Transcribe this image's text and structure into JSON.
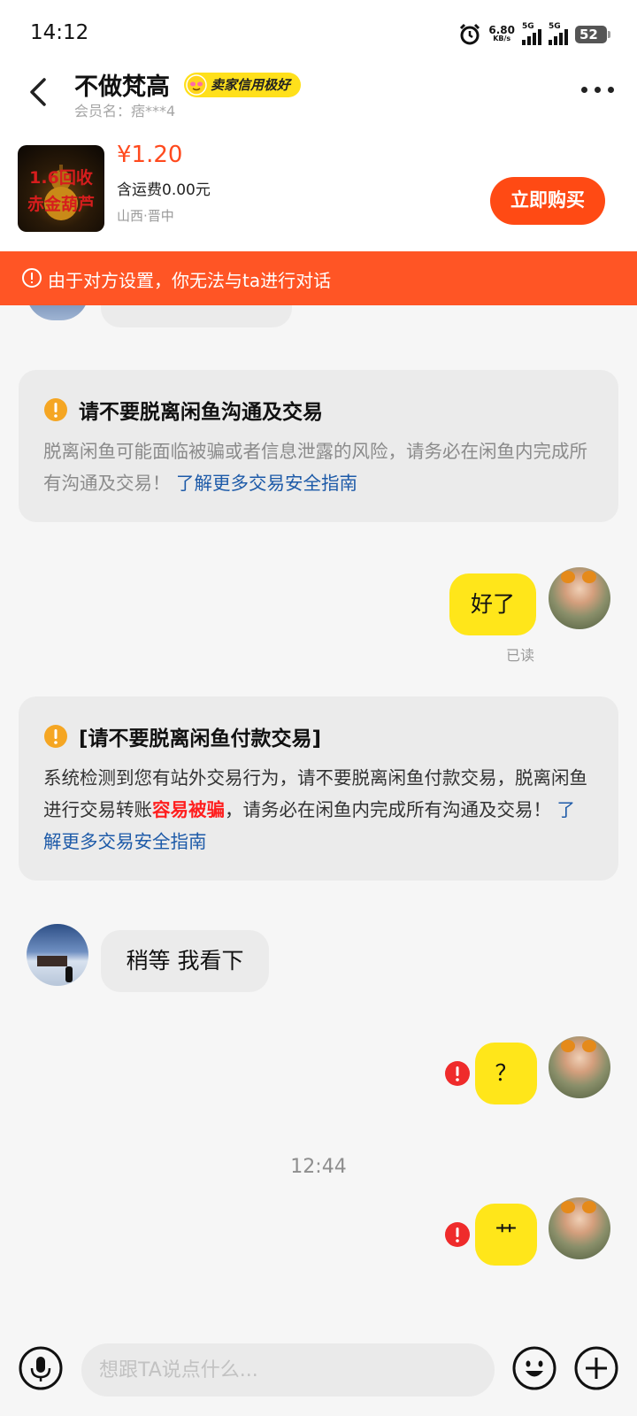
{
  "status_bar": {
    "time": "14:12",
    "net_speed_value": "6.80",
    "net_speed_unit": "KB/s",
    "signal_1_label": "5G",
    "signal_2_label": "5G",
    "battery": "52"
  },
  "header": {
    "seller_name": "不做梵高",
    "credit_badge": "卖家信用极好",
    "member_label": "会员名：痞***4"
  },
  "product": {
    "thumb_line1": "1.6回收",
    "thumb_line2": "赤金葫芦",
    "price": "¥1.20",
    "shipping": "含运费0.00元",
    "location": "山西·晋中",
    "buy_label": "立即购买"
  },
  "banner": {
    "text": "由于对方设置，你无法与ta进行对话"
  },
  "notices": [
    {
      "title": "请不要脱离闲鱼沟通及交易",
      "body": "脱离闲鱼可能面临被骗或者信息泄露的风险，请务必在闲鱼内完成所有沟通及交易！",
      "link": "了解更多交易安全指南"
    },
    {
      "title": "[请不要脱离闲鱼付款交易]",
      "body_before": "系统检测到您有站外交易行为，请不要脱离闲鱼付款交易，脱离闲鱼进行交易转账",
      "body_highlight": "容易被骗",
      "body_after": "，请务必在闲鱼内完成所有沟通及交易！",
      "link": "了解更多交易安全指南"
    }
  ],
  "messages": [
    {
      "from": "me",
      "text": "好了",
      "status": "已读"
    },
    {
      "from": "them",
      "text": "稍等 我看下"
    },
    {
      "from": "me",
      "text": "？",
      "failed": true
    },
    {
      "from": "me",
      "text": "艹",
      "failed": true
    }
  ],
  "timestamp": "12:44",
  "input": {
    "placeholder": "想跟TA说点什么..."
  },
  "colors": {
    "accent_orange": "#ff4a14",
    "banner_orange": "#ff5525",
    "bubble_yellow": "#ffe61a",
    "badge_yellow": "#ffe01b",
    "warning_orange": "#f5a623",
    "link_blue": "#1d5aa8",
    "error_red": "#ef2b2b"
  }
}
